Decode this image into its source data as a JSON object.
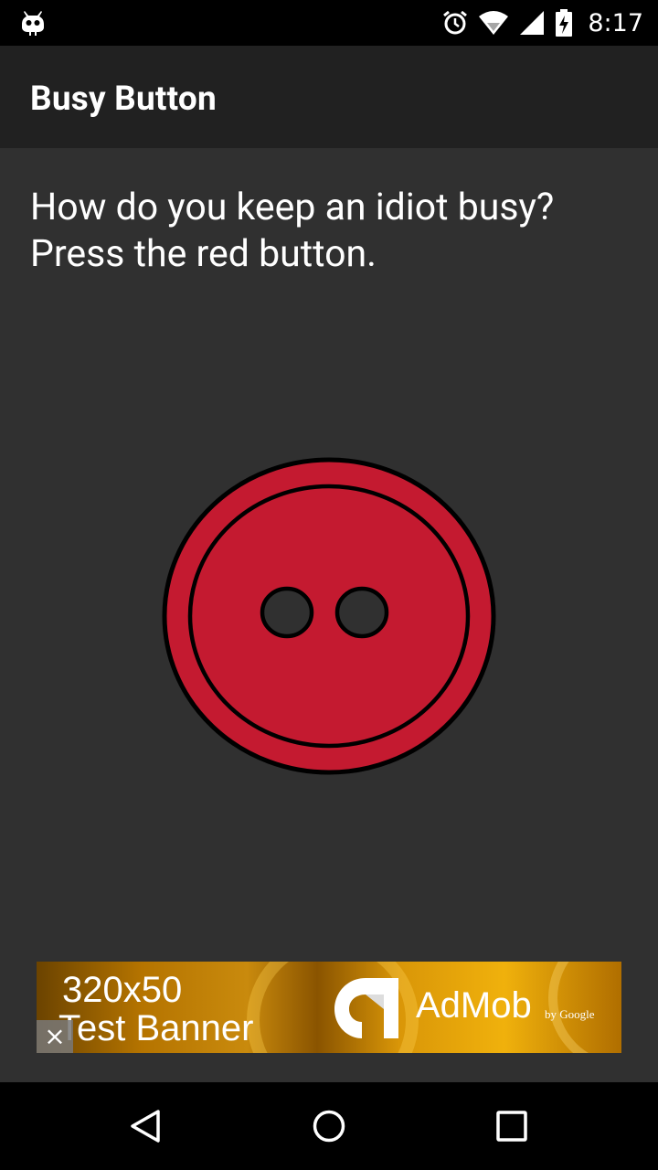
{
  "status_bar": {
    "time": "8:17",
    "icons": [
      "cyanogen-icon",
      "alarm-icon",
      "wifi-icon",
      "signal-icon",
      "battery-charging-icon"
    ]
  },
  "app_bar": {
    "title": "Busy Button"
  },
  "content": {
    "question_line1": "How do you keep an idiot busy?",
    "question_line2": "Press the red button."
  },
  "button": {
    "color": "#c41a30",
    "icon": "red-button-icon"
  },
  "ad": {
    "size_text": "320x50",
    "label_text": "Test Banner",
    "brand": "AdMob",
    "by": "by Google",
    "close": "×"
  },
  "nav_bar": {
    "icons": [
      "back-icon",
      "home-icon",
      "recents-icon"
    ]
  }
}
